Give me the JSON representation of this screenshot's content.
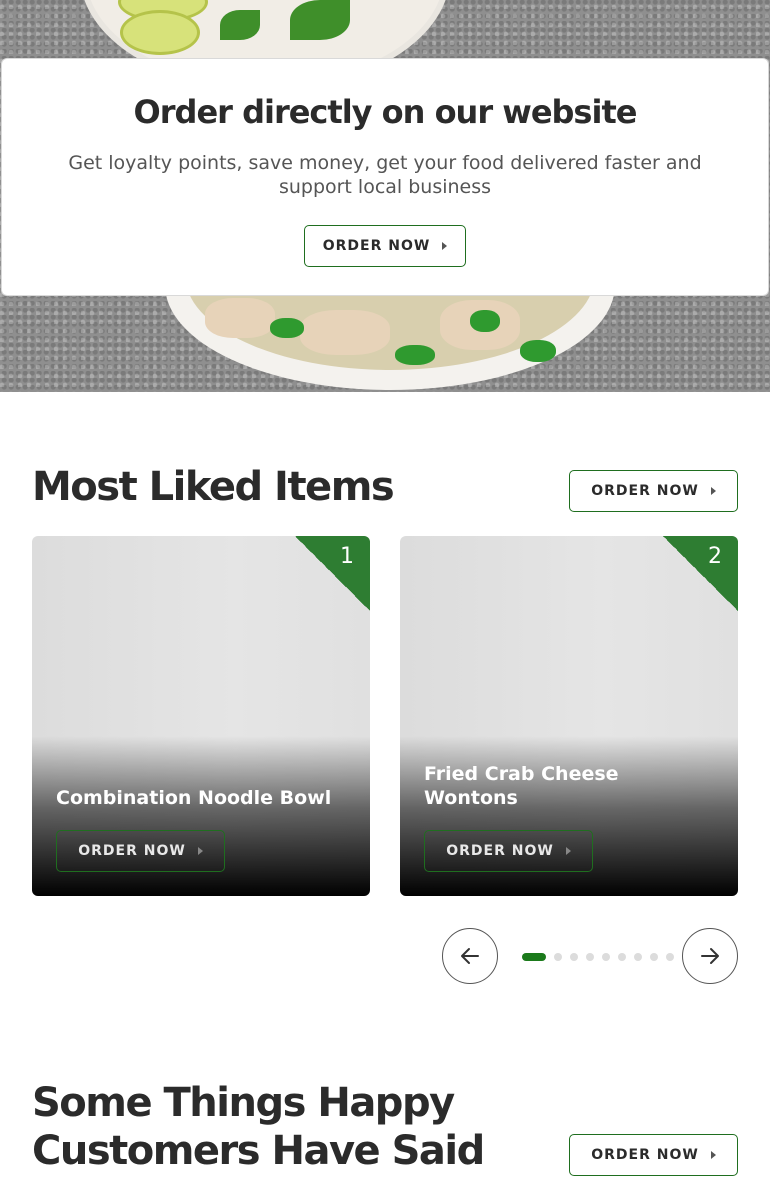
{
  "cta": {
    "title": "Order directly on our website",
    "subtitle": "Get loyalty points, save money, get your food delivered faster and support local business",
    "button_label": "ORDER NOW"
  },
  "most_liked": {
    "title": "Most Liked Items",
    "button_label": "ORDER NOW",
    "items": [
      {
        "rank": "1",
        "name": "Combination Noodle Bowl",
        "button_label": "ORDER NOW"
      },
      {
        "rank": "2",
        "name": "Fried Crab Cheese Wontons",
        "button_label": "ORDER NOW"
      }
    ],
    "carousel": {
      "total_pages": 9,
      "active_page": 1,
      "prev_icon": "arrow-left-icon",
      "next_icon": "arrow-right-icon"
    }
  },
  "testimonials": {
    "title_line1": "Some Things Happy",
    "title_line2": "Customers Have Said",
    "button_label": "ORDER NOW"
  },
  "colors": {
    "accent": "#1b7a1b",
    "rank_flag": "#2e7d32",
    "heading": "#2b2b2b"
  }
}
